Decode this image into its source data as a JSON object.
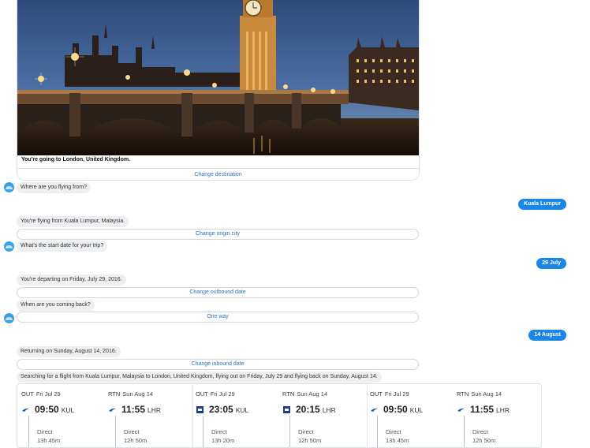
{
  "destination_card": {
    "caption": "You're going to London, United Kingdom.",
    "action": "Change destination"
  },
  "messages": {
    "ask_origin": "Where are you flying from?",
    "user_origin": "Kuala Lumpur",
    "origin_confirm": "You're flying from Kuala Lumpur, Malaysia.",
    "change_origin": "Change origin city",
    "ask_start": "What's the start date for your trip?",
    "user_start": "29 July",
    "depart_confirm": "You're departing on Friday, July 29, 2016.",
    "change_outbound": "Change outbound date",
    "ask_return": "When are you coming back?",
    "one_way": "One way",
    "user_return": "14 August",
    "return_confirm": "Returning on Sunday, August 14, 2016.",
    "change_inbound": "Change inbound date",
    "searching": "Searching for a flight from Kuala Lumpur, Malaysia to London, United Kingdom, flying out on Friday, July 29 and flying back on Sunday, August 14."
  },
  "flights": [
    {
      "out": {
        "dir": "OUT",
        "date": "Fri Jul 29",
        "time": "09:50",
        "code": "KUL",
        "stops": "Direct",
        "duration": "13h 45m",
        "airline_icon": "airline-swoosh-icon"
      },
      "rtn": {
        "dir": "RTN",
        "date": "Sun Aug 14",
        "time": "11:55",
        "code": "LHR",
        "stops": "Direct",
        "duration": "12h 50m",
        "airline_icon": "airline-swoosh-icon"
      }
    },
    {
      "out": {
        "dir": "OUT",
        "date": "Fri Jul 29",
        "time": "23:05",
        "code": "KUL",
        "stops": "Direct",
        "duration": "13h 20m",
        "airline_icon": "airline-square-icon"
      },
      "rtn": {
        "dir": "RTN",
        "date": "Sun Aug 14",
        "time": "20:15",
        "code": "LHR",
        "stops": "Direct",
        "duration": "12h 50m",
        "airline_icon": "airline-square-icon"
      }
    },
    {
      "out": {
        "dir": "OUT",
        "date": "Fri Jul 29",
        "time": "09:50",
        "code": "KUL",
        "stops": "Direct",
        "duration": "13h 45m",
        "airline_icon": "airline-swoosh-icon"
      },
      "rtn": {
        "dir": "RTN",
        "date": "Sun Aug 14",
        "time": "11:55",
        "code": "LHR",
        "stops": "Direct",
        "duration": "12h 50m",
        "airline_icon": "airline-swoosh-icon"
      }
    }
  ],
  "colors": {
    "accent": "#1a86e8",
    "link": "#2d74c9",
    "bubble": "#eeeff1"
  }
}
